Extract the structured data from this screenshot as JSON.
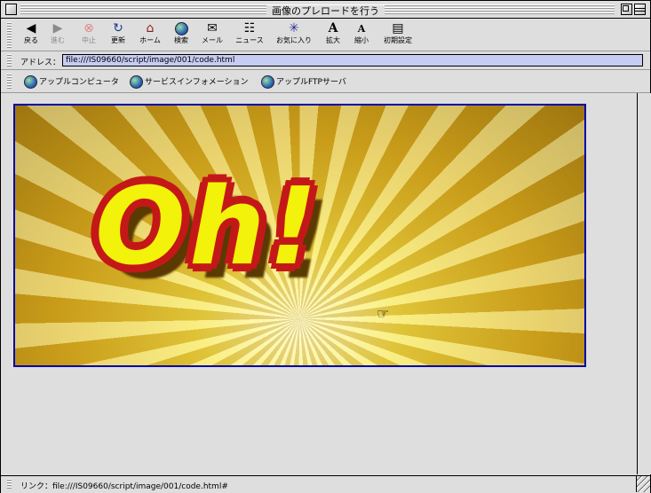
{
  "window": {
    "title": "画像のプレロードを行う"
  },
  "toolbar": {
    "buttons": [
      {
        "label": "戻る",
        "icon": "back-arrow-icon"
      },
      {
        "label": "進む",
        "icon": "forward-arrow-icon"
      },
      {
        "label": "中止",
        "icon": "stop-icon"
      },
      {
        "label": "更新",
        "icon": "refresh-icon"
      },
      {
        "label": "ホーム",
        "icon": "home-icon"
      },
      {
        "label": "検索",
        "icon": "search-icon"
      },
      {
        "label": "メール",
        "icon": "mail-icon"
      },
      {
        "label": "ニュース",
        "icon": "news-icon"
      },
      {
        "label": "お気に入り",
        "icon": "favorites-icon"
      },
      {
        "label": "拡大",
        "icon": "text-larger-icon"
      },
      {
        "label": "縮小",
        "icon": "text-smaller-icon"
      },
      {
        "label": "初期設定",
        "icon": "preferences-icon"
      }
    ]
  },
  "address": {
    "label": "アドレス：",
    "value": "file:///IS09660/script/image/001/code.html"
  },
  "favorites": [
    {
      "label": "アップルコンピュータ"
    },
    {
      "label": "サービスインフォメーション"
    },
    {
      "label": "アップルFTPサーバ"
    }
  ],
  "content": {
    "banner_text": "Oh!"
  },
  "status": {
    "text": "リンク：file:///IS09660/script/image/001/code.html#"
  }
}
